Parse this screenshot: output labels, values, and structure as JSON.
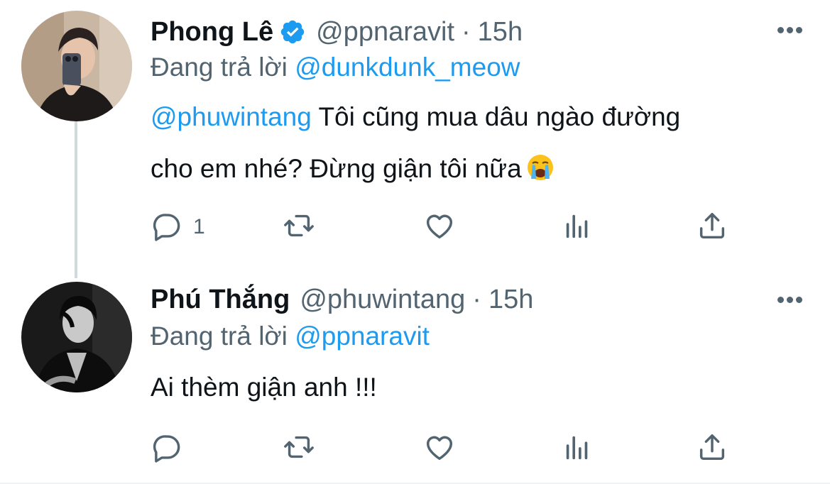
{
  "tweets": [
    {
      "name": "Phong Lê",
      "verified": true,
      "handle": "@ppnaravit",
      "separator": "·",
      "time": "15h",
      "reply_prefix": "Đang trả lời",
      "reply_to": "@dunkdunk_meow",
      "mention": "@phuwintang",
      "text_line1": " Tôi cũng mua dâu ngào đường",
      "text_line2": "cho em nhé? Đừng giận tôi nữa",
      "emoji": "loudly-crying-face",
      "reply_count": "1"
    },
    {
      "name": "Phú Thắng",
      "verified": false,
      "handle": "@phuwintang",
      "separator": "·",
      "time": "15h",
      "reply_prefix": "Đang trả lời",
      "reply_to": "@ppnaravit",
      "text": "Ai thèm giận anh !!!"
    }
  ],
  "icons": {
    "reply": "reply-icon",
    "retweet": "retweet-icon",
    "like": "heart-icon",
    "stats": "analytics-icon",
    "share": "share-icon",
    "more": "more-icon",
    "verified": "verified-badge-icon"
  },
  "colors": {
    "accent": "#1d9bf0",
    "secondary_text": "#536471",
    "primary_text": "#0f1419",
    "thread_line": "#cfd9de"
  }
}
